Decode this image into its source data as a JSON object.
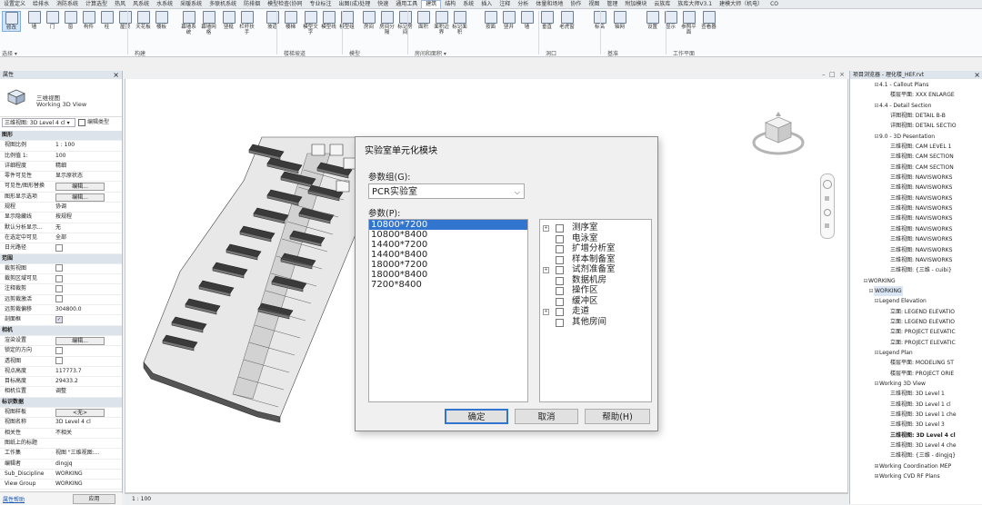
{
  "ribbon": {
    "tabs": [
      "设置定义",
      "给排水",
      "消防系统",
      "计算选型",
      "热风",
      "风系统",
      "水系统",
      "采暖系统",
      "多联机系统",
      "防排烟",
      "模型检查(协同",
      "专业标注",
      "出图(成)处理",
      "快速",
      "通用工具",
      "建筑",
      "结构",
      "系统",
      "插入",
      "注释",
      "分析",
      "体量和场地",
      "协作",
      "视图",
      "管理",
      "附加模块",
      "云族库",
      "族库大师V3.1",
      "建模大师（机电）",
      "CO"
    ],
    "active_tab": "建筑",
    "buttons": [
      {
        "label": "修改"
      },
      {
        "label": "墙"
      },
      {
        "label": "门"
      },
      {
        "label": "窗"
      },
      {
        "label": "构件"
      },
      {
        "label": "柱"
      },
      {
        "label": "屋顶"
      },
      {
        "label": "天花板"
      },
      {
        "label": "楼板"
      },
      {
        "label": "幕墙系统"
      },
      {
        "label": "幕墙网格"
      },
      {
        "label": "竖梃"
      },
      {
        "label": "栏杆扶手"
      },
      {
        "label": "坡道"
      },
      {
        "label": "楼梯"
      },
      {
        "label": "模型文字"
      },
      {
        "label": "模型线"
      },
      {
        "label": "模型组"
      },
      {
        "label": "房间"
      },
      {
        "label": "房间分隔"
      },
      {
        "label": "标记房间"
      },
      {
        "label": "面积"
      },
      {
        "label": "面积边界"
      },
      {
        "label": "标记面积"
      },
      {
        "label": "按面"
      },
      {
        "label": "竖井"
      },
      {
        "label": "墙"
      },
      {
        "label": "垂直"
      },
      {
        "label": "老虎窗"
      },
      {
        "label": "标高"
      },
      {
        "label": "轴网"
      },
      {
        "label": "设置"
      },
      {
        "label": "显示"
      },
      {
        "label": "参照平面"
      },
      {
        "label": "查看器"
      }
    ],
    "groups": [
      {
        "label": "选择 ▾"
      },
      {
        "label": "构建"
      },
      {
        "label": "楼梯坡道"
      },
      {
        "label": "模型"
      },
      {
        "label": "房间和面积 ▾"
      },
      {
        "label": "洞口"
      },
      {
        "label": "基准"
      },
      {
        "label": "工作平面"
      }
    ]
  },
  "properties": {
    "title": "属性",
    "type_name": "三维视图",
    "type_sub": "Working 3D View",
    "selector": "三维视图: 3D Level 4 cl ▾",
    "edit_type": "编辑类型",
    "rows": [
      {
        "k": "图形",
        "v": "",
        "sec": true
      },
      {
        "k": "视图比例",
        "v": "1 : 100"
      },
      {
        "k": "比例值 1:",
        "v": "100"
      },
      {
        "k": "详细程度",
        "v": "精细"
      },
      {
        "k": "零件可见性",
        "v": "显示原状态"
      },
      {
        "k": "可见性/图形替换",
        "v": "编辑...",
        "btn": true
      },
      {
        "k": "图形显示选项",
        "v": "编辑...",
        "btn": true
      },
      {
        "k": "规程",
        "v": "协调"
      },
      {
        "k": "显示隐藏线",
        "v": "按规程"
      },
      {
        "k": "默认分析显示...",
        "v": "无"
      },
      {
        "k": "在选定中可见",
        "v": "全部"
      },
      {
        "k": "日光路径",
        "v": "",
        "cb": true
      },
      {
        "k": "范围",
        "v": "",
        "sec": true
      },
      {
        "k": "裁剪视图",
        "v": "",
        "cb": true
      },
      {
        "k": "裁剪区域可见",
        "v": "",
        "cb": true
      },
      {
        "k": "注释裁剪",
        "v": "",
        "cb": true
      },
      {
        "k": "远剪裁激活",
        "v": "",
        "cb": true
      },
      {
        "k": "远剪裁偏移",
        "v": "304800.0"
      },
      {
        "k": "剖面框",
        "v": "",
        "cb": true,
        "on": true
      },
      {
        "k": "相机",
        "v": "",
        "sec": true
      },
      {
        "k": "渲染设置",
        "v": "编辑...",
        "btn": true
      },
      {
        "k": "锁定的方向",
        "v": "",
        "cb": true
      },
      {
        "k": "透视图",
        "v": "",
        "cb": true
      },
      {
        "k": "视点高度",
        "v": "117773.7"
      },
      {
        "k": "目标高度",
        "v": "29433.2"
      },
      {
        "k": "相机位置",
        "v": "调整"
      },
      {
        "k": "标识数据",
        "v": "",
        "sec": true
      },
      {
        "k": "视图样板",
        "v": "<无>",
        "btn": true
      },
      {
        "k": "视图名称",
        "v": "3D Level 4 cl"
      },
      {
        "k": "相关性",
        "v": "不相关"
      },
      {
        "k": "图纸上的标题",
        "v": ""
      },
      {
        "k": "工作集",
        "v": "视图 \"三维视图:..."
      },
      {
        "k": "编辑者",
        "v": "dingjq"
      },
      {
        "k": "Sub_Discipline",
        "v": "WORKING"
      },
      {
        "k": "View Group",
        "v": "WORKING"
      }
    ],
    "help_link": "属性帮助",
    "apply": "应用"
  },
  "statusbar": {
    "scale": "1 : 100"
  },
  "browser": {
    "title": "项目浏览器 - 理化楼_HEF.rvt",
    "items": [
      {
        "t": "4.1 - Callout Plans",
        "lvl": 1,
        "tg": "−"
      },
      {
        "t": "楼层平面: XXX ENLARGE",
        "lvl": 2
      },
      {
        "t": "4.4 - Detail Section",
        "lvl": 1,
        "tg": "−"
      },
      {
        "t": "详图视图: DETAIL B-B",
        "lvl": 2
      },
      {
        "t": "详图视图: DETAIL SECTIO",
        "lvl": 2
      },
      {
        "t": "9.0 - 3D Pesentation",
        "lvl": 1,
        "tg": "−"
      },
      {
        "t": "三维视图: CAM  LEVEL 1",
        "lvl": 2
      },
      {
        "t": "三维视图: CAM  SECTION",
        "lvl": 2
      },
      {
        "t": "三维视图: CAM  SECTION",
        "lvl": 2
      },
      {
        "t": "三维视图: NAVISWORKS",
        "lvl": 2
      },
      {
        "t": "三维视图: NAVISWORKS",
        "lvl": 2
      },
      {
        "t": "三维视图: NAVISWORKS",
        "lvl": 2
      },
      {
        "t": "三维视图: NAVISWORKS",
        "lvl": 2
      },
      {
        "t": "三维视图: NAVISWORKS",
        "lvl": 2
      },
      {
        "t": "三维视图: NAVISWORKS",
        "lvl": 2
      },
      {
        "t": "三维视图: NAVISWORKS",
        "lvl": 2
      },
      {
        "t": "三维视图: NAVISWORKS",
        "lvl": 2
      },
      {
        "t": "三维视图: NAVISWORKS",
        "lvl": 2
      },
      {
        "t": "三维视图: {三维 - cuibi}",
        "lvl": 2
      },
      {
        "t": "WORKING",
        "lvl": 0,
        "tg": "−"
      },
      {
        "t": "WORKING",
        "lvl": 0.5,
        "tg": "−",
        "hl": true
      },
      {
        "t": "Legend  Elevation",
        "lvl": 1,
        "tg": "−"
      },
      {
        "t": "立面: LEGEND ELEVATIO",
        "lvl": 2
      },
      {
        "t": "立面: LEGEND ELEVATIO",
        "lvl": 2
      },
      {
        "t": "立面: PROJECT ELEVATIC",
        "lvl": 2
      },
      {
        "t": "立面: PROJECT ELEVATIC",
        "lvl": 2
      },
      {
        "t": "Legend Plan",
        "lvl": 1,
        "tg": "−"
      },
      {
        "t": "楼层平面: MODELING ST",
        "lvl": 2
      },
      {
        "t": "楼层平面: PROJECT ORIE",
        "lvl": 2
      },
      {
        "t": "Working 3D View",
        "lvl": 1,
        "tg": "−"
      },
      {
        "t": "三维视图: 3D Level 1",
        "lvl": 2
      },
      {
        "t": "三维视图: 3D Level 1 cl",
        "lvl": 2
      },
      {
        "t": "三维视图: 3D Level 1 che",
        "lvl": 2
      },
      {
        "t": "三维视图: 3D Level 3",
        "lvl": 2
      },
      {
        "t": "三维视图: 3D Level 4 cl",
        "lvl": 2,
        "bold": true
      },
      {
        "t": "三维视图: 3D Level 4 che",
        "lvl": 2
      },
      {
        "t": "三维视图: {三维 - dingjq}",
        "lvl": 2
      },
      {
        "t": "Working Coordination MEP",
        "lvl": 1,
        "tg": "+"
      },
      {
        "t": "Working CVD RF Plans",
        "lvl": 1,
        "tg": "+"
      }
    ]
  },
  "dialog": {
    "title": "实验室单元化模块",
    "group_label": "参数组(G):",
    "group_value": "PCR实验室",
    "params_label": "参数(P):",
    "params": [
      "10800*7200",
      "10800*8400",
      "14400*7200",
      "14400*8400",
      "18000*7200",
      "18000*8400",
      "7200*8400"
    ],
    "selected_param": "10800*7200",
    "rooms": [
      {
        "label": "测序室",
        "expand": true
      },
      {
        "label": "电泳室",
        "expand": false
      },
      {
        "label": "扩增分析室",
        "expand": false
      },
      {
        "label": "样本制备室",
        "expand": false
      },
      {
        "label": "试剂准备室",
        "expand": true
      },
      {
        "label": "数据机房",
        "expand": false
      },
      {
        "label": "操作区",
        "expand": false
      },
      {
        "label": "缓冲区",
        "expand": false
      },
      {
        "label": "走道",
        "expand": true
      },
      {
        "label": "其他房间",
        "expand": false
      }
    ],
    "ok": "确定",
    "cancel": "取消",
    "help": "帮助(H)"
  }
}
